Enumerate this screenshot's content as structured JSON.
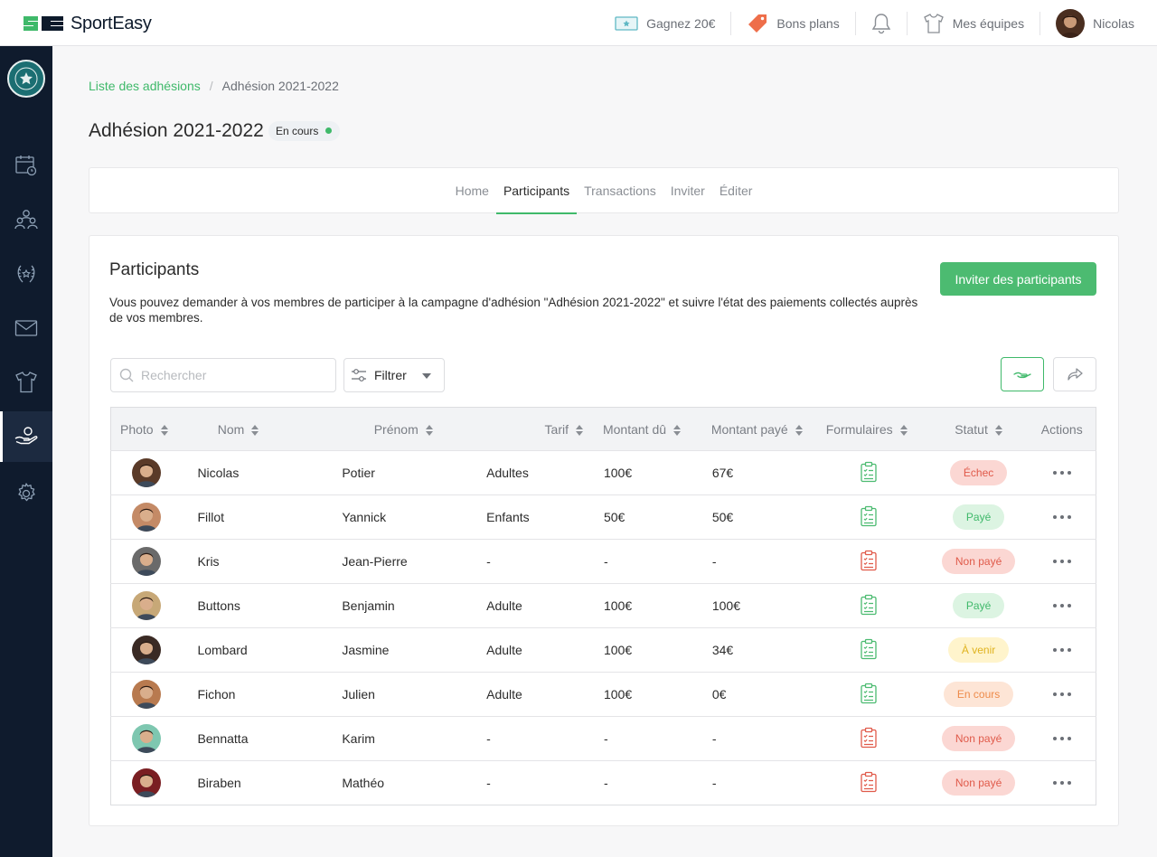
{
  "brand": {
    "name_bold": "Sport",
    "name_rest": "Easy",
    "accent": "#3fb96a",
    "navy": "#0f1b2d"
  },
  "topnav": {
    "gagnez": "Gagnez 20€",
    "bons_plans": "Bons plans",
    "mes_equipes": "Mes équipes",
    "user": "Nicolas"
  },
  "breadcrumb": {
    "parent": "Liste des adhésions",
    "separator": "/",
    "current": "Adhésion 2021-2022"
  },
  "page": {
    "title": "Adhésion 2021-2022",
    "status": "En cours"
  },
  "tabs": [
    {
      "label": "Home"
    },
    {
      "label": "Participants",
      "active": true
    },
    {
      "label": "Transactions"
    },
    {
      "label": "Inviter"
    },
    {
      "label": "Éditer"
    }
  ],
  "card": {
    "title": "Participants",
    "description": "Vous pouvez demander à vos membres de participer à la campagne d'adhésion \"Adhésion 2021-2022\" et suivre l'état des paiements collectés auprès de vos membres.",
    "invite_button": "Inviter des participants"
  },
  "toolbar": {
    "search_placeholder": "Rechercher",
    "filter_label": "Filtrer"
  },
  "table": {
    "headers": [
      "Photo",
      "Nom",
      "Prénom",
      "Tarif",
      "Montant dû",
      "Montant payé",
      "Formulaires",
      "Statut",
      "Actions"
    ],
    "rows": [
      {
        "nom": "Nicolas",
        "prenom": "Potier",
        "tarif": "Adultes",
        "du": "100€",
        "paye": "67€",
        "form": "ok",
        "statut": "Échec",
        "statut_class": "echec",
        "avatar": "#5a3a28"
      },
      {
        "nom": "Fillot",
        "prenom": "Yannick",
        "tarif": "Enfants",
        "du": "50€",
        "paye": "50€",
        "form": "ok",
        "statut": "Payé",
        "statut_class": "paye",
        "avatar": "#c48a66"
      },
      {
        "nom": "Kris",
        "prenom": "Jean-Pierre",
        "tarif": "-",
        "du": "-",
        "paye": "-",
        "form": "ko",
        "statut": "Non payé",
        "statut_class": "nonpaye",
        "avatar": "#6a6a6a"
      },
      {
        "nom": "Buttons",
        "prenom": "Benjamin",
        "tarif": "Adulte",
        "du": "100€",
        "paye": "100€",
        "form": "ok",
        "statut": "Payé",
        "statut_class": "paye",
        "avatar": "#c7a877"
      },
      {
        "nom": "Lombard",
        "prenom": "Jasmine",
        "tarif": "Adulte",
        "du": "100€",
        "paye": "34€",
        "form": "ok",
        "statut": "À venir",
        "statut_class": "avenir",
        "avatar": "#3a2a24"
      },
      {
        "nom": "Fichon",
        "prenom": "Julien",
        "tarif": "Adulte",
        "du": "100€",
        "paye": "0€",
        "form": "ok",
        "statut": "En cours",
        "statut_class": "encours",
        "avatar": "#b87a4f"
      },
      {
        "nom": "Bennatta",
        "prenom": "Karim",
        "tarif": "-",
        "du": "-",
        "paye": "-",
        "form": "ko",
        "statut": "Non payé",
        "statut_class": "nonpaye",
        "avatar": "#7ec7b0"
      },
      {
        "nom": "Biraben",
        "prenom": "Mathéo",
        "tarif": "-",
        "du": "-",
        "paye": "-",
        "form": "ko",
        "statut": "Non payé",
        "statut_class": "nonpaye",
        "avatar": "#7a1e22"
      }
    ]
  },
  "icons": {
    "sidebar": [
      "calendar-icon",
      "members-icon",
      "trophy-icon",
      "mail-icon",
      "jersey-icon",
      "payment-icon",
      "settings-icon"
    ],
    "form_ok_color": "#4cbb71",
    "form_ko_color": "#e05a4a"
  }
}
